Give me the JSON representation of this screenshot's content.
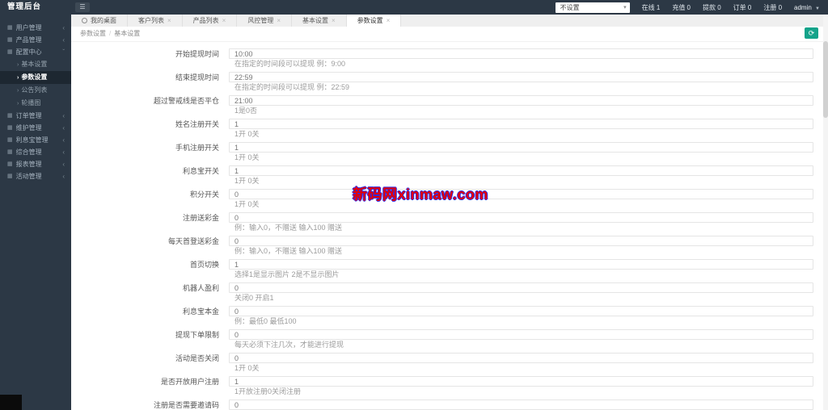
{
  "app": {
    "title": "管理后台"
  },
  "topbar": {
    "select": {
      "value": "不设置"
    },
    "stats": [
      {
        "label": "在线",
        "value": "1"
      },
      {
        "label": "充值",
        "value": "0"
      },
      {
        "label": "提款",
        "value": "0"
      },
      {
        "label": "订单",
        "value": "0"
      },
      {
        "label": "注册",
        "value": "0"
      }
    ],
    "user": {
      "name": "admin"
    }
  },
  "sidebar": {
    "items": [
      {
        "label": "用户管理",
        "type": "top",
        "expanded": false
      },
      {
        "label": "产品管理",
        "type": "top",
        "expanded": false
      },
      {
        "label": "配置中心",
        "type": "top",
        "expanded": true
      },
      {
        "label": "基本设置",
        "type": "sub",
        "active": false
      },
      {
        "label": "参数设置",
        "type": "sub",
        "active": true
      },
      {
        "label": "公告列表",
        "type": "sub",
        "active": false
      },
      {
        "label": "轮播图",
        "type": "sub",
        "active": false
      },
      {
        "label": "订单管理",
        "type": "top",
        "expanded": false
      },
      {
        "label": "维护管理",
        "type": "top",
        "expanded": false
      },
      {
        "label": "利息宝管理",
        "type": "top",
        "expanded": false
      },
      {
        "label": "综合管理",
        "type": "top",
        "expanded": false
      },
      {
        "label": "报表管理",
        "type": "top",
        "expanded": false
      },
      {
        "label": "活动管理",
        "type": "top",
        "expanded": false
      }
    ]
  },
  "tabs": [
    {
      "label": "我的桌面",
      "closable": false,
      "active": false,
      "icon": "circle-icon"
    },
    {
      "label": "客户列表",
      "closable": true,
      "active": false
    },
    {
      "label": "产品列表",
      "closable": true,
      "active": false
    },
    {
      "label": "风控管理",
      "closable": true,
      "active": false
    },
    {
      "label": "基本设置",
      "closable": true,
      "active": false
    },
    {
      "label": "参数设置",
      "closable": true,
      "active": true
    }
  ],
  "breadcrumb": {
    "parts": [
      "参数设置",
      "基本设置"
    ],
    "separator": "/"
  },
  "form": {
    "rows": [
      {
        "label": "开始提现时间",
        "value": "10:00",
        "hint": "在指定的时间段可以提现 例：9:00"
      },
      {
        "label": "结束提现时间",
        "value": "22:59",
        "hint": "在指定的时间段可以提现 例：22:59"
      },
      {
        "label": "超过警戒线是否平仓",
        "value": "21:00",
        "hint": "1是0否"
      },
      {
        "label": "姓名注册开关",
        "value": "1",
        "hint": "1开 0关"
      },
      {
        "label": "手机注册开关",
        "value": "1",
        "hint": "1开 0关"
      },
      {
        "label": "利息宝开关",
        "value": "1",
        "hint": "1开 0关"
      },
      {
        "label": "积分开关",
        "value": "0",
        "hint": "1开 0关"
      },
      {
        "label": "注册送彩金",
        "value": "0",
        "hint": "例：输入0，不赠送 输入100 赠送"
      },
      {
        "label": "每天首登送彩金",
        "value": "0",
        "hint": "例：输入0，不赠送 输入100 赠送"
      },
      {
        "label": "首页切换",
        "value": "1",
        "hint": "选择1是显示图片 2是不显示图片"
      },
      {
        "label": "机器人盈利",
        "value": "0",
        "hint": "关闭0 开启1"
      },
      {
        "label": "利息宝本金",
        "value": "0",
        "hint": "例：最低0 最低100"
      },
      {
        "label": "提现下单限制",
        "value": "0",
        "hint": "每天必须下注几次，才能进行提现"
      },
      {
        "label": "活动是否关闭",
        "value": "0",
        "hint": "1开 0关"
      },
      {
        "label": "是否开放用户注册",
        "value": "1",
        "hint": "1开放注册0关闭注册"
      },
      {
        "label": "注册是否需要邀请码",
        "value": "0",
        "hint": ""
      }
    ]
  },
  "watermark": {
    "text": "新码网xinmaw.com",
    "text_color": "#e60000",
    "outline_color": "#2a2af0"
  },
  "colors": {
    "accent_teal": "#15a38a",
    "sidebar_bg": "#2c3845",
    "active_item_bg": "#1d2731"
  }
}
